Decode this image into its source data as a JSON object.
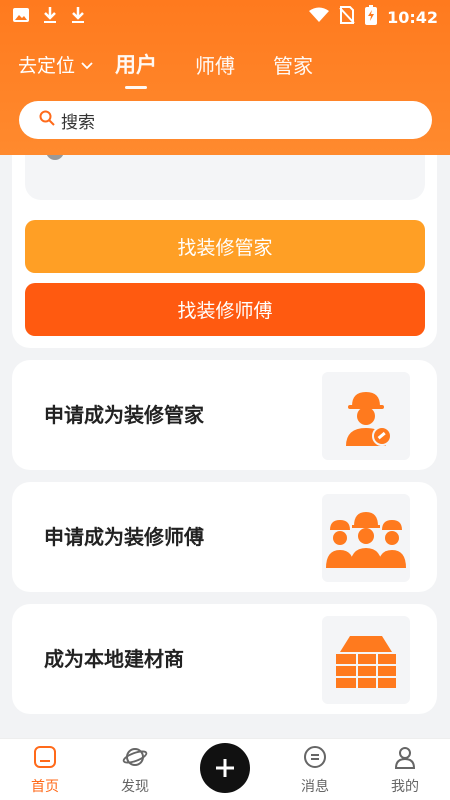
{
  "status": {
    "time": "10:42"
  },
  "nav": {
    "location": "去定位",
    "tabs": [
      {
        "label": "用户",
        "active": true
      },
      {
        "label": "师傅",
        "active": false
      },
      {
        "label": "管家",
        "active": false
      }
    ]
  },
  "search": {
    "placeholder": "搜索"
  },
  "main": {
    "buttons": {
      "find_manager": "找装修管家",
      "find_master": "找装修师傅"
    },
    "apply_cards": [
      {
        "label": "申请成为装修管家",
        "icon": "manager-worker-icon"
      },
      {
        "label": "申请成为装修师傅",
        "icon": "workers-group-icon"
      },
      {
        "label": "成为本地建材商",
        "icon": "building-materials-icon"
      }
    ]
  },
  "bottom_nav": [
    {
      "label": "首页",
      "icon": "home-icon",
      "active": true
    },
    {
      "label": "发现",
      "icon": "planet-icon",
      "active": false
    },
    {
      "label": "",
      "icon": "plus-icon",
      "active": false
    },
    {
      "label": "消息",
      "icon": "message-icon",
      "active": false
    },
    {
      "label": "我的",
      "icon": "user-icon",
      "active": false
    }
  ],
  "colors": {
    "header_orange": "#ff7a1e",
    "button_orange_light": "#ff9f25",
    "button_orange_dark": "#ff5a10",
    "active_nav": "#ff6a1a",
    "icon_orange": "#ff7a1e"
  }
}
